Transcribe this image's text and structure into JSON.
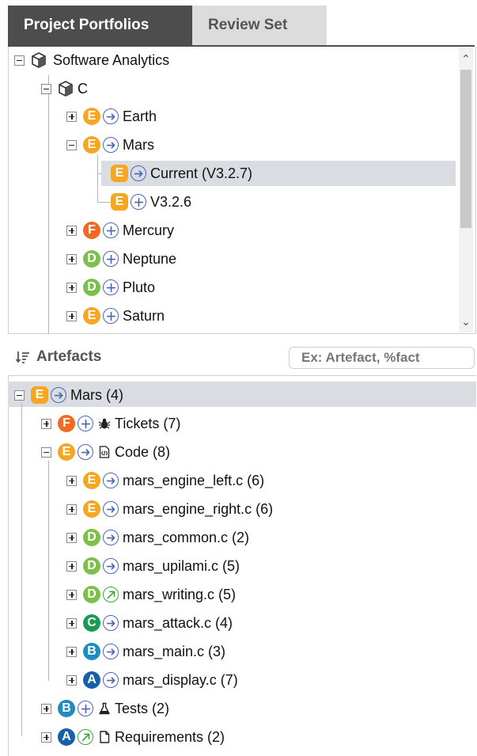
{
  "tabs": [
    {
      "label": "Project Portfolios",
      "active": true
    },
    {
      "label": "Review Set",
      "active": false
    }
  ],
  "colors": {
    "E": "#f5a623",
    "F": "#f26a21",
    "D": "#7cc04b",
    "C": "#1a9a54",
    "B": "#1f8bbf",
    "A": "#1660a8",
    "arrow_blue": "#4a66b8",
    "arrow_green": "#39a63b",
    "tab_active": "#4d4d4d",
    "highlight": "#d9dde1"
  },
  "portfolio_tree": {
    "root": {
      "label": "Software Analytics",
      "icon": "cube-icon"
    },
    "group": {
      "label": "C",
      "icon": "cube-icon"
    },
    "items": [
      {
        "label": "Earth",
        "rating": "E",
        "trend": "arrow-right-icon"
      },
      {
        "label": "Mars",
        "rating": "E",
        "trend": "arrow-right-icon"
      },
      {
        "label": "Current (V3.2.7)",
        "rating": "E",
        "trend": "arrow-right-icon"
      },
      {
        "label": "V3.2.6",
        "rating": "E",
        "trend": "plus-icon"
      },
      {
        "label": "Mercury",
        "rating": "F",
        "trend": "plus-icon"
      },
      {
        "label": "Neptune",
        "rating": "D",
        "trend": "plus-icon"
      },
      {
        "label": "Pluto",
        "rating": "D",
        "trend": "plus-icon"
      },
      {
        "label": "Saturn",
        "rating": "E",
        "trend": "plus-icon"
      }
    ]
  },
  "artefacts": {
    "title": "Artefacts",
    "search_placeholder": "Ex: Artefact, %fact",
    "root": {
      "label": "Mars (4)",
      "rating": "E",
      "trend": "arrow-right-icon"
    },
    "children": [
      {
        "label": "Tickets (7)",
        "rating": "F",
        "trend": "plus-icon",
        "icon": "bug-icon"
      },
      {
        "label": "Code (8)",
        "rating": "E",
        "trend": "arrow-right-icon",
        "icon": "code-file-icon"
      },
      {
        "label": "Tests (2)",
        "rating": "B",
        "trend": "plus-icon",
        "icon": "flask-icon"
      },
      {
        "label": "Requirements (2)",
        "rating": "A",
        "trend": "arrow-up-right-icon",
        "icon": "document-icon"
      }
    ],
    "code_files": [
      {
        "label": "mars_engine_left.c (6)",
        "rating": "E",
        "trend": "arrow-right-icon"
      },
      {
        "label": "mars_engine_right.c (6)",
        "rating": "E",
        "trend": "arrow-right-icon"
      },
      {
        "label": "mars_common.c (2)",
        "rating": "D",
        "trend": "arrow-right-icon"
      },
      {
        "label": "mars_upilami.c (5)",
        "rating": "D",
        "trend": "arrow-right-icon"
      },
      {
        "label": "mars_writing.c (5)",
        "rating": "D",
        "trend": "arrow-up-right-icon"
      },
      {
        "label": "mars_attack.c (4)",
        "rating": "C",
        "trend": "arrow-right-icon"
      },
      {
        "label": "mars_main.c (3)",
        "rating": "B",
        "trend": "arrow-right-icon"
      },
      {
        "label": "mars_display.c (7)",
        "rating": "A",
        "trend": "arrow-right-icon"
      }
    ]
  }
}
